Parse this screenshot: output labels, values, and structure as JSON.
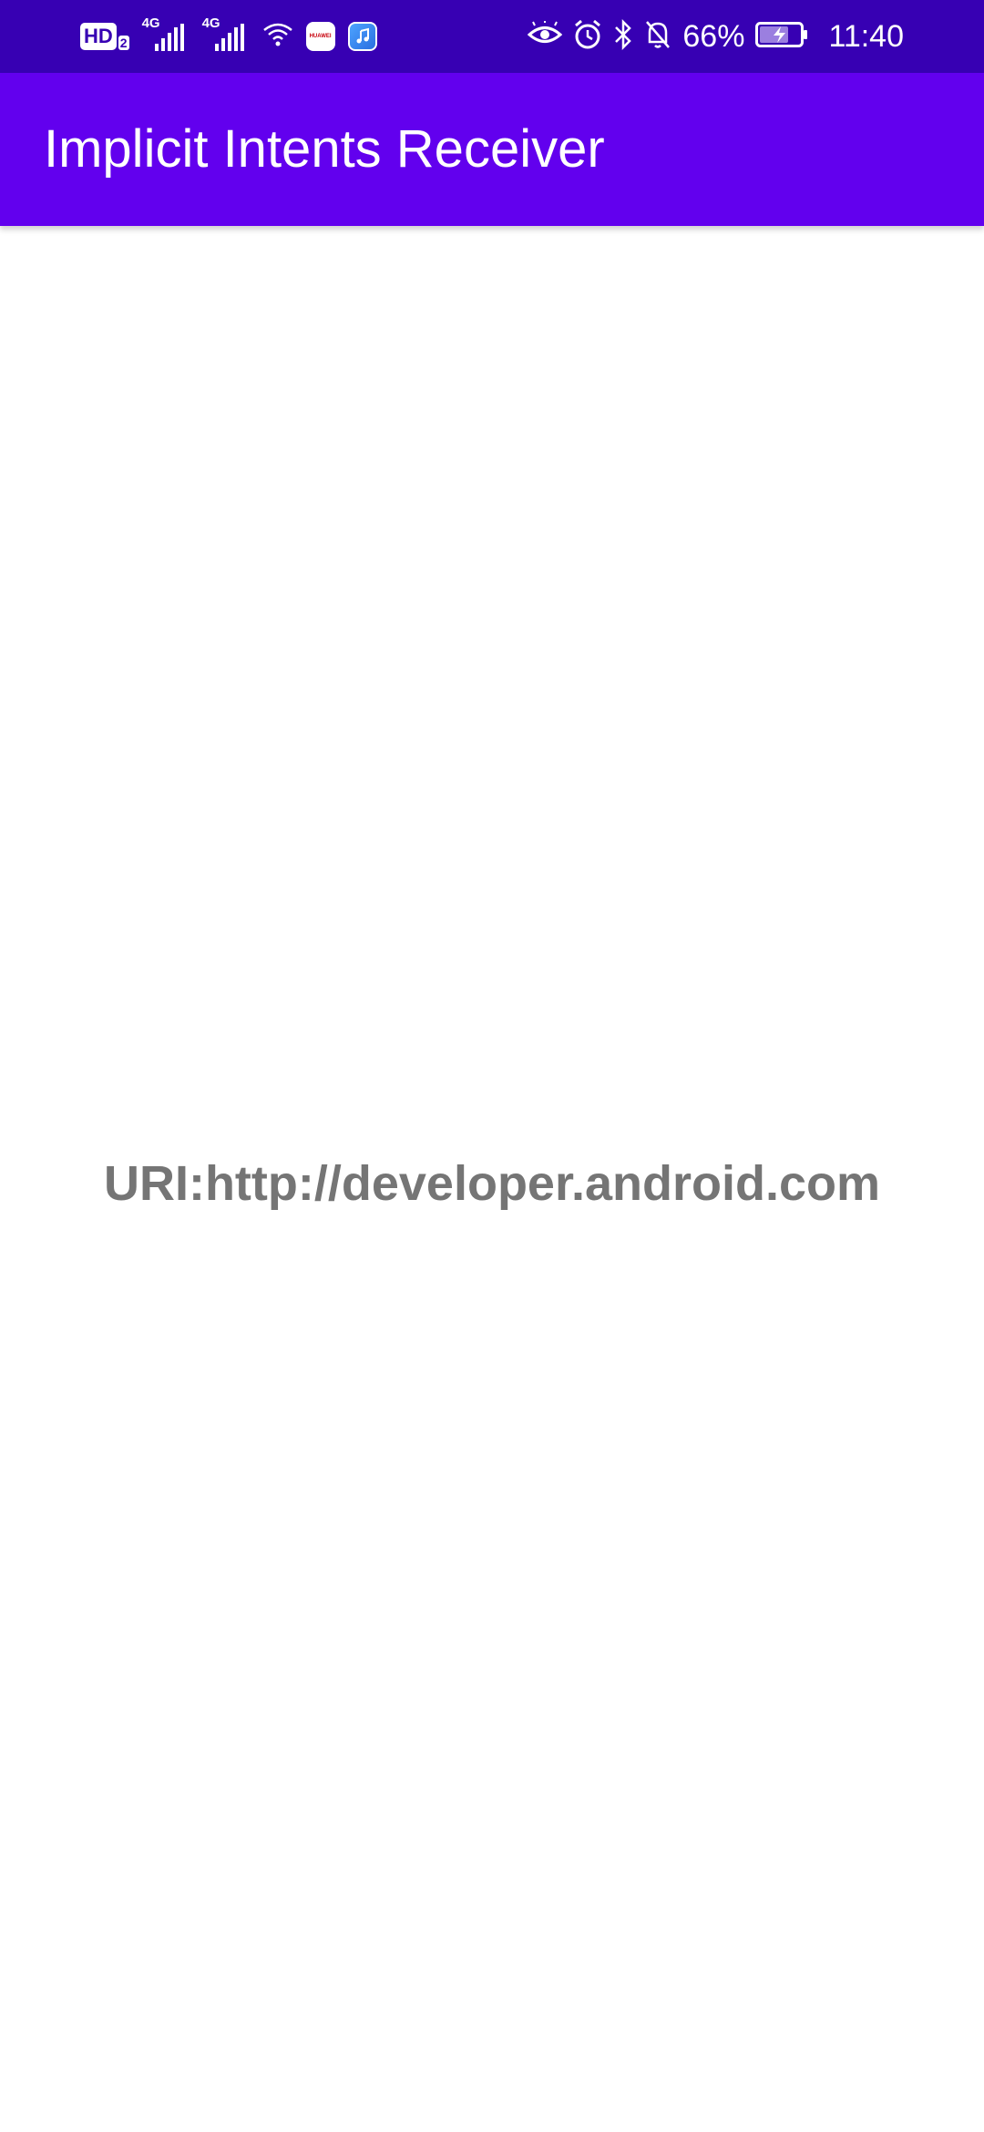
{
  "status_bar": {
    "hd_label": "HD",
    "hd_sub": "2",
    "network_1": "4G",
    "network_2": "4G",
    "app_icon_1_label": "HUAWEI",
    "icons_left": [
      "hd-icon",
      "signal-icon",
      "signal-icon",
      "wifi-icon",
      "huawei-appgallery-icon",
      "music-icon"
    ],
    "icons_right": [
      "eye-icon",
      "alarm-icon",
      "bluetooth-icon",
      "mute-bell-icon",
      "battery-charging-icon"
    ],
    "battery_percent": "66%",
    "time": "11:40"
  },
  "app_bar": {
    "title": "Implicit Intents Receiver"
  },
  "main": {
    "uri_text": "URI:http://developer.android.com"
  },
  "colors": {
    "status_bar": "#3700B3",
    "app_bar": "#6200EE",
    "text_secondary": "#757575",
    "background": "#FFFFFF"
  }
}
